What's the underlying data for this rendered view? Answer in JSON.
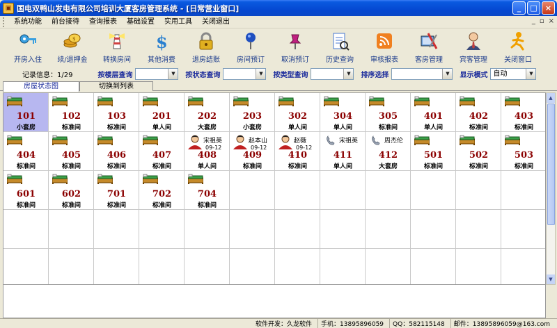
{
  "window": {
    "title": "国电双鸭山发电有限公司培训大厦客房管理系统 - [日常营业窗口]",
    "buttons": {
      "minimize": "_",
      "maximize": "□",
      "close": "×"
    }
  },
  "menu": {
    "items": [
      "系统功能",
      "前台接待",
      "查询报表",
      "基础设置",
      "实用工具",
      "关闭退出"
    ],
    "right_controls": [
      "_",
      "▫",
      "×"
    ]
  },
  "toolbar": {
    "items": [
      {
        "label": "开房入住",
        "icon": "key-icon",
        "color": "#3aa0e0"
      },
      {
        "label": "续/退押金",
        "icon": "coins-icon",
        "color": "#e0a020"
      },
      {
        "label": "转换房间",
        "icon": "lighthouse-icon",
        "color": "#d04040"
      },
      {
        "label": "其他消费",
        "icon": "dollar-icon",
        "color": "#2a80d0"
      },
      {
        "label": "退房结账",
        "icon": "lock-icon",
        "color": "#e0b020"
      },
      {
        "label": "房间预订",
        "icon": "pin-icon",
        "color": "#2050c0"
      },
      {
        "label": "取消预订",
        "icon": "pushpin-icon",
        "color": "#c02080"
      },
      {
        "label": "历史查询",
        "icon": "document-icon",
        "color": "#4a7ad0"
      },
      {
        "label": "审核报表",
        "icon": "rss-icon",
        "color": "#f08020"
      },
      {
        "label": "客房管理",
        "icon": "tools-icon",
        "color": "#d03030"
      },
      {
        "label": "宾客管理",
        "icon": "person-icon",
        "color": "#c04040"
      },
      {
        "label": "关闭窗口",
        "icon": "runner-icon",
        "color": "#f0a000"
      }
    ]
  },
  "filters": {
    "record_info": "记录信息：1/29",
    "floor_label": "按楼层查询",
    "floor_value": "",
    "status_label": "按状态查询",
    "status_value": "",
    "type_label": "按类型查询",
    "type_value": "",
    "sort_label": "排序选择",
    "sort_value": "",
    "mode_label": "显示模式",
    "mode_value": "自动"
  },
  "tabs": {
    "active": "房屋状态图",
    "other": "切换到列表"
  },
  "rooms": [
    {
      "no": "101",
      "type": "小套房",
      "state": "selected"
    },
    {
      "no": "102",
      "type": "标准间",
      "state": "vacant"
    },
    {
      "no": "103",
      "type": "标准间",
      "state": "vacant"
    },
    {
      "no": "201",
      "type": "单人间",
      "state": "vacant"
    },
    {
      "no": "202",
      "type": "大套房",
      "state": "vacant"
    },
    {
      "no": "203",
      "type": "小套房",
      "state": "vacant"
    },
    {
      "no": "302",
      "type": "单人间",
      "state": "vacant"
    },
    {
      "no": "304",
      "type": "单人间",
      "state": "vacant"
    },
    {
      "no": "305",
      "type": "标准间",
      "state": "vacant"
    },
    {
      "no": "401",
      "type": "单人间",
      "state": "vacant"
    },
    {
      "no": "402",
      "type": "标准间",
      "state": "vacant"
    },
    {
      "no": "403",
      "type": "标准间",
      "state": "vacant"
    },
    {
      "no": "404",
      "type": "标准间",
      "state": "vacant"
    },
    {
      "no": "405",
      "type": "标准间",
      "state": "vacant"
    },
    {
      "no": "406",
      "type": "标准间",
      "state": "vacant"
    },
    {
      "no": "407",
      "type": "标准间",
      "state": "vacant"
    },
    {
      "no": "408",
      "type": "单人间",
      "state": "occupied",
      "guest": "宋祖英",
      "date": "09-12"
    },
    {
      "no": "409",
      "type": "标准间",
      "state": "occupied",
      "guest": "赵本山",
      "date": "09-12"
    },
    {
      "no": "410",
      "type": "标准间",
      "state": "occupied",
      "guest": "赵薇",
      "date": "09-12"
    },
    {
      "no": "411",
      "type": "单人间",
      "state": "reserved",
      "guest": "宋祖英"
    },
    {
      "no": "412",
      "type": "大套房",
      "state": "reserved",
      "guest": "周杰伦"
    },
    {
      "no": "501",
      "type": "标准间",
      "state": "vacant"
    },
    {
      "no": "502",
      "type": "标准间",
      "state": "vacant"
    },
    {
      "no": "503",
      "type": "标准间",
      "state": "vacant"
    },
    {
      "no": "601",
      "type": "标准间",
      "state": "vacant"
    },
    {
      "no": "602",
      "type": "标准间",
      "state": "vacant"
    },
    {
      "no": "701",
      "type": "标准间",
      "state": "vacant"
    },
    {
      "no": "702",
      "type": "标准间",
      "state": "vacant"
    },
    {
      "no": "704",
      "type": "标准间",
      "state": "vacant"
    }
  ],
  "status": {
    "developer": "软件开发：久龙软件",
    "phone": "手机：13895896059",
    "qq": "QQ：582115148",
    "email": "邮件：13895896059@163.com"
  }
}
